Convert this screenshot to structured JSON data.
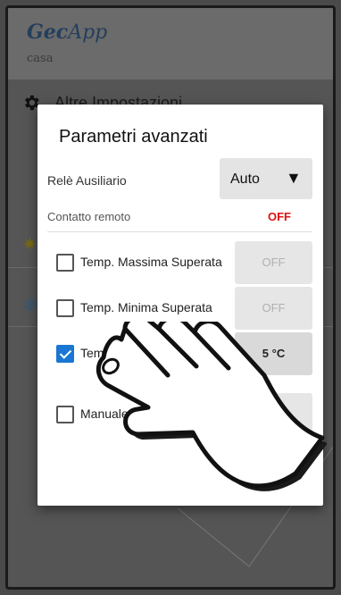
{
  "app": {
    "brand_part1": "Gec",
    "brand_part2": "App",
    "subtitle": "casa"
  },
  "settings": {
    "label": "Altre Impostazioni",
    "icon": "gear-icon"
  },
  "background_icons": [
    "sun-icon",
    "snowflake-icon"
  ],
  "dialog": {
    "title": "Parametri avanzati",
    "relay": {
      "label": "Relè Ausiliario",
      "value": "Auto"
    },
    "contatto": {
      "label": "Contatto remoto",
      "value": "OFF",
      "value_color": "#e01010"
    },
    "rows": [
      {
        "label": "Temp. Massima Superata",
        "checked": false,
        "button": "OFF"
      },
      {
        "label": "Temp. Minima Superata",
        "checked": false,
        "button": "OFF"
      },
      {
        "label": "Temp. Antigelo",
        "checked": true,
        "button": "5 °C"
      },
      {
        "label": "Manuale a",
        "checked": false,
        "button": ""
      }
    ]
  },
  "colors": {
    "checkbox_checked": "#1976d2",
    "brand": "#243f5c"
  }
}
